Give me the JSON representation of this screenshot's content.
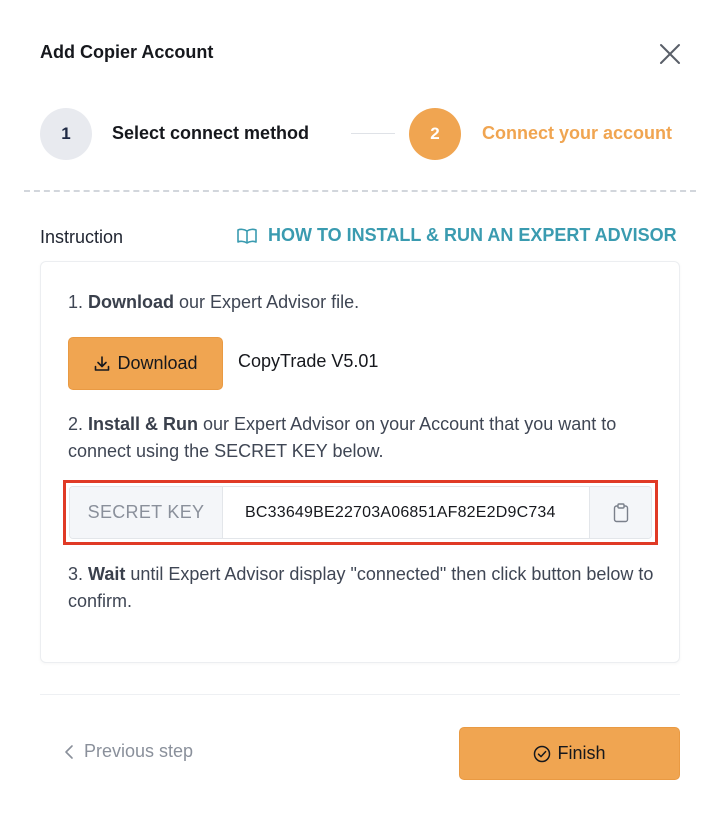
{
  "modal": {
    "title": "Add Copier Account"
  },
  "steps": [
    {
      "number": "1",
      "label": "Select connect method",
      "state": "done"
    },
    {
      "number": "2",
      "label": "Connect your account",
      "state": "active"
    }
  ],
  "instruction": {
    "label": "Instruction",
    "howto_link": "HOW TO INSTALL & RUN AN EXPERT ADVISOR"
  },
  "step1": {
    "prefix": "1. ",
    "bold": "Download",
    "rest": " our Expert Advisor file.",
    "download_button": "Download",
    "version": "CopyTrade V5.01"
  },
  "step2": {
    "prefix": "2. ",
    "bold": "Install & Run",
    "rest": " our Expert Advisor on your Account that you want to connect using the SECRET KEY below.",
    "secret_label": "SECRET KEY",
    "secret_value": "BC33649BE22703A06851AF82E2D9C734"
  },
  "step3": {
    "prefix": "3. ",
    "bold": "Wait",
    "rest": " until Expert Advisor display \"connected\" then click button below to confirm."
  },
  "footer": {
    "previous": "Previous step",
    "finish": "Finish"
  },
  "colors": {
    "accent": "#f0a551",
    "link": "#3a9bb0",
    "highlight": "#e03a26"
  },
  "icons": {
    "close": "close-icon",
    "book": "book-icon",
    "download": "download-icon",
    "clipboard": "clipboard-icon",
    "chevron": "chevron-left-icon",
    "check": "check-circle-icon"
  }
}
